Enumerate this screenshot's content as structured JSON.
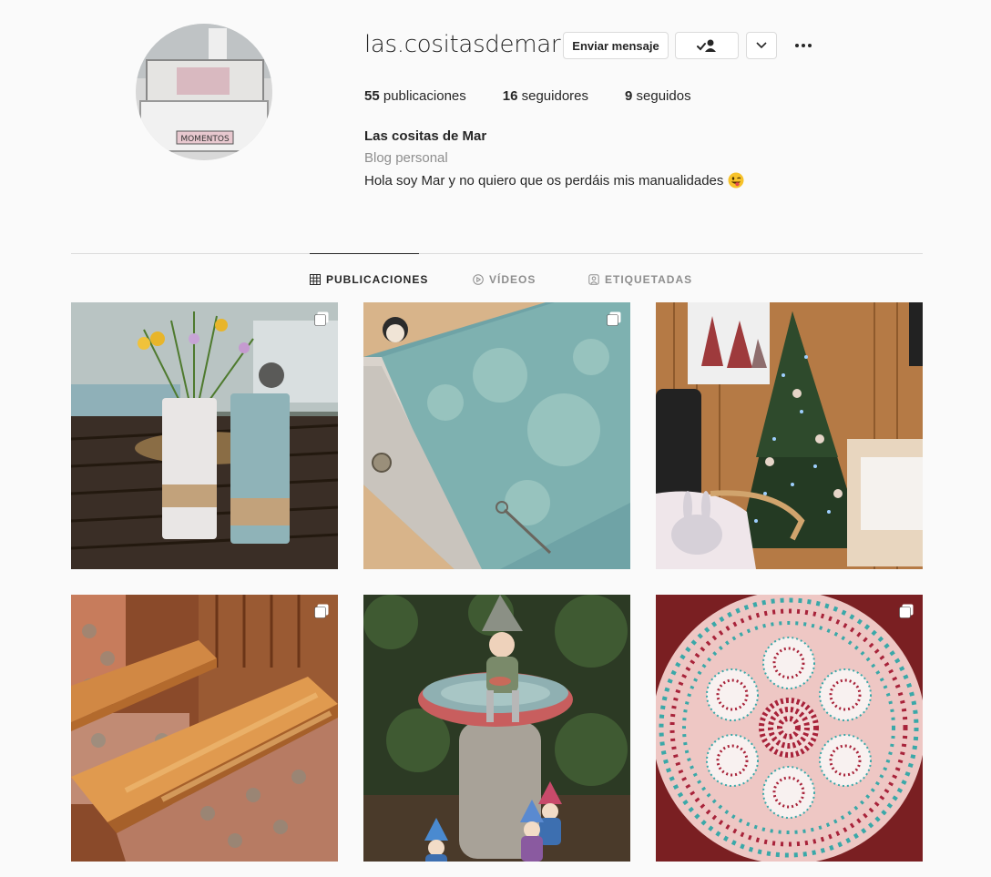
{
  "profile": {
    "username": "las.cositasdemar",
    "avatar_label": "MOMENTOS",
    "buttons": {
      "message": "Enviar mensaje",
      "follow_icon": "person-check-icon",
      "more_icon": "chevron-down-icon",
      "options_icon": "ellipsis-icon"
    },
    "stats": {
      "posts_count": "55",
      "posts_label": "publicaciones",
      "followers_count": "16",
      "followers_label": "seguidores",
      "following_count": "9",
      "following_label": "seguidos"
    },
    "bio": {
      "name": "Las cositas de Mar",
      "category": "Blog personal",
      "text": "Hola soy Mar y no quiero que os perdáis mis manualidades",
      "emoji": "winking-face-with-tongue"
    }
  },
  "tabs": [
    {
      "label": "PUBLICACIONES",
      "icon": "grid-icon",
      "active": true
    },
    {
      "label": "VÍDEOS",
      "icon": "play-icon",
      "active": false
    },
    {
      "label": "ETIQUETADAS",
      "icon": "tag-person-icon",
      "active": false
    }
  ],
  "posts": [
    {
      "subject": "flower-vases",
      "multiple": true
    },
    {
      "subject": "book-box",
      "multiple": true
    },
    {
      "subject": "christmas-tree",
      "multiple": false
    },
    {
      "subject": "wooden-stairs",
      "multiple": true
    },
    {
      "subject": "gnome-mushroom",
      "multiple": false
    },
    {
      "subject": "dotted-plate",
      "multiple": true
    }
  ],
  "colors": {
    "background": "#fafafa",
    "text": "#262626",
    "secondary": "#8e8e8e",
    "border": "#dbdbdb"
  }
}
